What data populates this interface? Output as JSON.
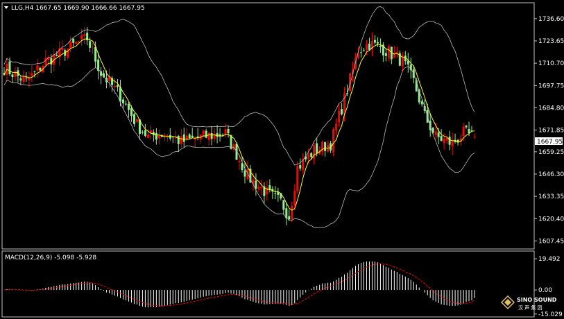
{
  "header": {
    "symbol_line": "LLG,H4  1667.65 1669.90 1666.66 1667.95",
    "macd_label": "MACD(12,26,9) -5.098 -5.928"
  },
  "logo": {
    "brand": "SINO SOUND",
    "tagline": "汉 声 集 团"
  },
  "colors": {
    "bull": "#ff0000",
    "bear": "#90ee90",
    "ma": "#ffff00",
    "bands": "#bbbbbb",
    "macd_hist": "#ffffff",
    "macd_signal": "#ff0000",
    "background": "#000000"
  },
  "chart_data": [
    {
      "type": "candlestick",
      "title": "LLG,H4",
      "ohlc_last": {
        "open": 1667.65,
        "high": 1669.9,
        "low": 1666.66,
        "close": 1667.95
      },
      "ylim": [
        1604,
        1745
      ],
      "y_ticks": [
        "1736.60",
        "1723.65",
        "1710.70",
        "1697.75",
        "1684.80",
        "1671.85",
        "1659.25",
        "1646.30",
        "1633.35",
        "1620.40",
        "1607.45"
      ],
      "current_price_label": "1667.95",
      "overlays": [
        "Bollinger Bands",
        "Moving Average"
      ],
      "close_anchors": [
        [
          0,
          1708
        ],
        [
          8,
          1700
        ],
        [
          15,
          1712
        ],
        [
          20,
          1716
        ],
        [
          26,
          1722
        ],
        [
          30,
          1725
        ],
        [
          35,
          1705
        ],
        [
          42,
          1692
        ],
        [
          48,
          1675
        ],
        [
          52,
          1668
        ],
        [
          58,
          1670
        ],
        [
          64,
          1665
        ],
        [
          72,
          1668
        ],
        [
          80,
          1670
        ],
        [
          84,
          1658
        ],
        [
          88,
          1645
        ],
        [
          95,
          1635
        ],
        [
          100,
          1630
        ],
        [
          103,
          1622
        ],
        [
          106,
          1650
        ],
        [
          112,
          1660
        ],
        [
          118,
          1664
        ],
        [
          123,
          1690
        ],
        [
          128,
          1718
        ],
        [
          132,
          1722
        ],
        [
          136,
          1720
        ],
        [
          140,
          1716
        ],
        [
          144,
          1712
        ],
        [
          148,
          1700
        ],
        [
          152,
          1680
        ],
        [
          156,
          1668
        ],
        [
          162,
          1664
        ],
        [
          166,
          1670
        ],
        [
          170,
          1668
        ]
      ],
      "candle_count": 171
    },
    {
      "type": "histogram",
      "title": "MACD(12,26,9)",
      "values_last": {
        "macd": -5.098,
        "signal": -5.928
      },
      "ylim": [
        -16,
        20
      ],
      "y_ticks": [
        "19.492",
        "0.00",
        "-15.029"
      ],
      "series": [
        {
          "name": "MACD",
          "kind": "histogram"
        },
        {
          "name": "Signal",
          "kind": "line"
        }
      ]
    }
  ]
}
